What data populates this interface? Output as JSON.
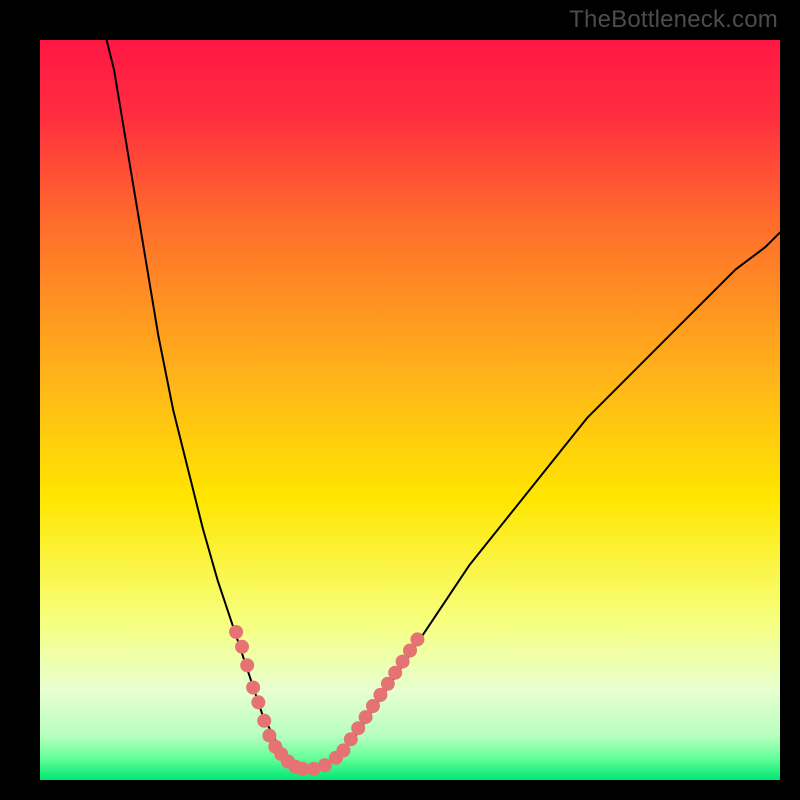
{
  "watermark": "TheBottleneck.com",
  "chart_data": {
    "type": "line",
    "title": "",
    "xlabel": "",
    "ylabel": "",
    "xlim": [
      0,
      100
    ],
    "ylim": [
      0,
      100
    ],
    "grid": false,
    "legend": false,
    "background_gradient": {
      "stops": [
        {
          "offset": 0.0,
          "color": "#ff1744"
        },
        {
          "offset": 0.1,
          "color": "#ff2d3f"
        },
        {
          "offset": 0.25,
          "color": "#ff6e2b"
        },
        {
          "offset": 0.45,
          "color": "#ffb21a"
        },
        {
          "offset": 0.62,
          "color": "#ffe600"
        },
        {
          "offset": 0.78,
          "color": "#f7ff7a"
        },
        {
          "offset": 0.88,
          "color": "#e8ffd0"
        },
        {
          "offset": 0.94,
          "color": "#b7ffc0"
        },
        {
          "offset": 0.97,
          "color": "#66ff99"
        },
        {
          "offset": 1.0,
          "color": "#00e676"
        }
      ]
    },
    "series": [
      {
        "name": "v-curve",
        "stroke": "#000000",
        "stroke_width": 2,
        "x": [
          9,
          10,
          11,
          12,
          13,
          14,
          15,
          16,
          18,
          20,
          22,
          24,
          26,
          28,
          30,
          31,
          32,
          33,
          34,
          35,
          36,
          38,
          40,
          42,
          44,
          46,
          48,
          50,
          54,
          58,
          62,
          66,
          70,
          74,
          78,
          82,
          86,
          90,
          94,
          98,
          100
        ],
        "y": [
          100,
          96,
          90,
          84,
          78,
          72,
          66,
          60,
          50,
          42,
          34,
          27,
          21,
          15,
          9,
          7,
          5,
          3,
          2,
          1.5,
          1.5,
          2,
          3,
          5,
          8,
          11,
          14,
          17,
          23,
          29,
          34,
          39,
          44,
          49,
          53,
          57,
          61,
          65,
          69,
          72,
          74
        ]
      }
    ],
    "markers": {
      "name": "highlighted-points",
      "color": "#e57373",
      "radius": 7,
      "points": [
        {
          "x": 26.5,
          "y": 20
        },
        {
          "x": 27.3,
          "y": 18
        },
        {
          "x": 28.0,
          "y": 15.5
        },
        {
          "x": 28.8,
          "y": 12.5
        },
        {
          "x": 29.5,
          "y": 10.5
        },
        {
          "x": 30.3,
          "y": 8.0
        },
        {
          "x": 31.0,
          "y": 6.0
        },
        {
          "x": 31.8,
          "y": 4.5
        },
        {
          "x": 32.6,
          "y": 3.5
        },
        {
          "x": 33.5,
          "y": 2.5
        },
        {
          "x": 34.5,
          "y": 1.8
        },
        {
          "x": 35.5,
          "y": 1.5
        },
        {
          "x": 37.0,
          "y": 1.5
        },
        {
          "x": 38.5,
          "y": 2.0
        },
        {
          "x": 40.0,
          "y": 3.0
        },
        {
          "x": 41.0,
          "y": 4.0
        },
        {
          "x": 42.0,
          "y": 5.5
        },
        {
          "x": 43.0,
          "y": 7.0
        },
        {
          "x": 44.0,
          "y": 8.5
        },
        {
          "x": 45.0,
          "y": 10.0
        },
        {
          "x": 46.0,
          "y": 11.5
        },
        {
          "x": 47.0,
          "y": 13.0
        },
        {
          "x": 48.0,
          "y": 14.5
        },
        {
          "x": 49.0,
          "y": 16.0
        },
        {
          "x": 50.0,
          "y": 17.5
        },
        {
          "x": 51.0,
          "y": 19.0
        }
      ]
    }
  }
}
